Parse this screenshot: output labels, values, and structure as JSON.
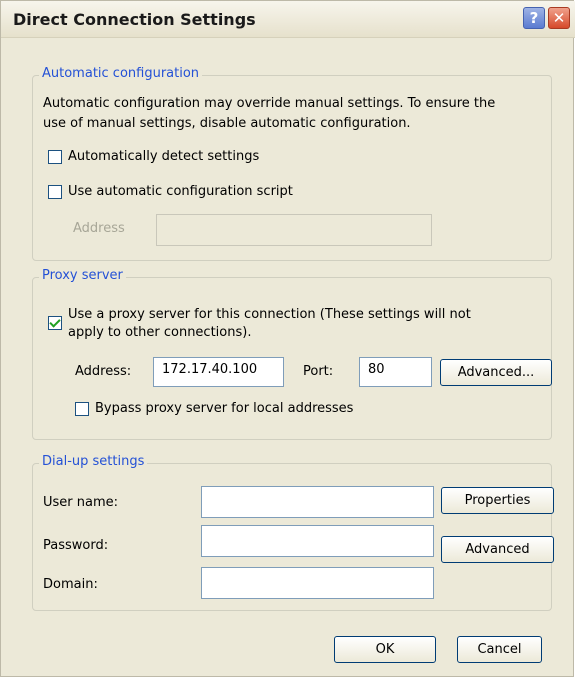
{
  "window": {
    "title": "Direct Connection Settings",
    "help_glyph": "?",
    "close_glyph": "✕"
  },
  "auto_config": {
    "legend": "Automatic configuration",
    "desc_line1": "Automatic configuration may override manual settings.  To ensure the",
    "desc_line2": "use of manual settings, disable automatic configuration.",
    "detect_label": "Automatically detect settings",
    "detect_checked": false,
    "script_label": "Use automatic configuration script",
    "script_checked": false,
    "address_label": "Address",
    "address_value": ""
  },
  "proxy": {
    "legend": "Proxy server",
    "use_proxy_line1": "Use a proxy server for this connection (These settings will not",
    "use_proxy_line2": "apply to other connections).",
    "use_proxy_checked": true,
    "address_label": "Address:",
    "address_value": "172.17.40.100",
    "port_label": "Port:",
    "port_value": "80",
    "advanced_label": "Advanced...",
    "bypass_label": "Bypass proxy server for local addresses",
    "bypass_checked": false
  },
  "dialup": {
    "legend": "Dial-up settings",
    "user_label": "User name:",
    "user_value": "",
    "password_label": "Password:",
    "password_value": "",
    "domain_label": "Domain:",
    "domain_value": "",
    "properties_label": "Properties",
    "advanced_label": "Advanced"
  },
  "footer": {
    "ok_label": "OK",
    "cancel_label": "Cancel"
  }
}
